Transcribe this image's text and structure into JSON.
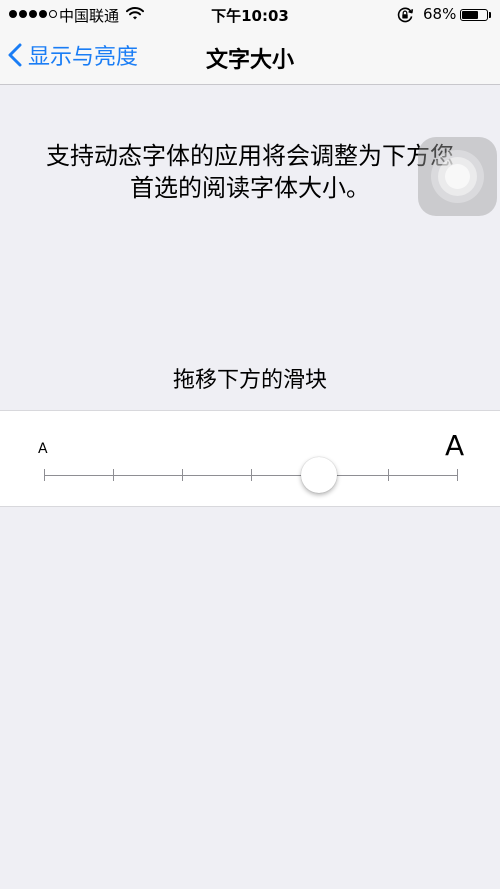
{
  "status_bar": {
    "carrier": "中国联通",
    "time": "下午10:03",
    "battery_percent_label": "68%",
    "battery_level": 0.68,
    "signal_bars_filled": 4,
    "signal_bars_total": 5,
    "icons": [
      "wifi-icon",
      "rotation-lock-icon",
      "battery-icon"
    ]
  },
  "nav": {
    "back_label": "显示与亮度",
    "title": "文字大小"
  },
  "description": [
    "支持动态字体的应用将会调整为下方您",
    "首选的阅读字体大小。"
  ],
  "drag_hint": "拖移下方的滑块",
  "slider": {
    "min_label": "A",
    "max_label": "A",
    "steps": 7,
    "selected_index": 4
  },
  "colors": {
    "accent": "#1a7df5",
    "background": "#efeff4",
    "bar_background": "#f7f7f7",
    "panel": "#ffffff",
    "track": "#8e8e93"
  }
}
